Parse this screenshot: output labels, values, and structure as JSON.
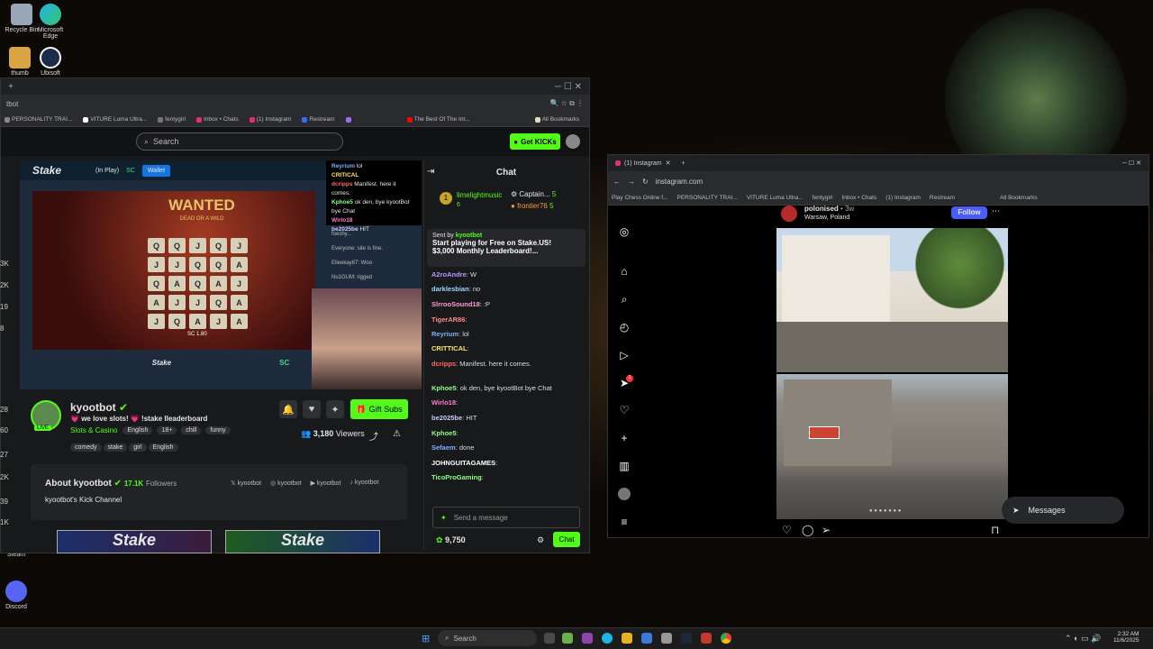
{
  "desktop": {
    "icons": [
      {
        "label": "Recycle Bin"
      },
      {
        "label": "Microsoft Edge"
      },
      {
        "label": "thumb"
      },
      {
        "label": "Ubisoft"
      },
      {
        "label": "Steam"
      },
      {
        "label": "Discord"
      }
    ],
    "edge_numbers": [
      "3K",
      "2K",
      "19",
      "8",
      "28",
      "60",
      "27",
      "2K",
      "39",
      "1K"
    ]
  },
  "kick_window": {
    "tab_title": "tbot",
    "bookmarks": [
      "PERSONALITY TRAI...",
      "VITURE Luma Ultra...",
      "fentygirl",
      "Inbox • Chats",
      "(1) Instagram",
      "Restream",
      "The Best Of The Int...",
      "All Bookmarks"
    ],
    "search_placeholder": "Search",
    "get_kicks_label": "Get KICKs",
    "stream": {
      "site_logo": "Stake",
      "in_play": "(In Play)",
      "currency": "SC",
      "wallet_label": "Wallet",
      "game_title": "WANTED",
      "game_subtitle": "DEAD OR A WILD",
      "balance": "SC 1.80",
      "footer_logo": "Stake",
      "footer_currency": "SC",
      "overlay_chat": [
        {
          "user": "Reyrium",
          "msg": "lol"
        },
        {
          "user": "CRITICAL",
          "msg": ""
        },
        {
          "user": "dcripps",
          "msg": "Manifest. here it comes."
        },
        {
          "user": "Kphoe5",
          "msg": "ok den, bye kyootBot bye Chat"
        },
        {
          "user": "Wirlo18",
          "msg": ""
        },
        {
          "user": "be2025be",
          "msg": "HIT"
        }
      ],
      "overlay_chat2": [
        "foeshy...",
        "Everyone: site is fine.",
        "Elleekay87: Woo",
        "Nu1GUM: rigged"
      ]
    },
    "streamer": {
      "name": "kyootbot",
      "title": "we love slots! 💗 !stake lleaderboard",
      "category": "Slots & Casino",
      "tags": [
        "English",
        "18+",
        "chill",
        "funny"
      ],
      "tags2": [
        "comedy",
        "stake",
        "girl",
        "English"
      ],
      "viewers": "3,180",
      "viewers_label": "Viewers",
      "live_label": "LIVE",
      "gift_subs": "Gift Subs"
    },
    "about": {
      "title": "About kyootbot",
      "followers": "17.1K",
      "followers_label": "Followers",
      "description": "kyootbot's Kick Channel",
      "socials": [
        "kyootbot",
        "kyootbot",
        "kyootbot",
        "kyootbot"
      ]
    },
    "banners": [
      "Stake",
      "Stake"
    ],
    "chat": {
      "header": "Chat",
      "leaders": [
        {
          "rank": "1",
          "name": "limelightmusic",
          "count": "6"
        },
        {
          "name": "Captain...",
          "count": "5"
        },
        {
          "name": "frontier76",
          "count": "5"
        }
      ],
      "pinned": {
        "sent_by": "Sent by",
        "pinner": "kyootbot",
        "line1": "Start playing for Free on Stake.US!",
        "line2": "$3,000 Monthly Leaderboard!..."
      },
      "messages": [
        {
          "user": "A2roAndre",
          "color": "#b59bff",
          "msg": "W"
        },
        {
          "user": "darklesbian",
          "color": "#9fd6ff",
          "msg": "no"
        },
        {
          "user": "SlrrooSound18",
          "color": "#ff9bd4",
          "msg": ":P"
        },
        {
          "user": "TigerAR86",
          "color": "#ff8a8a",
          "msg": ""
        },
        {
          "user": "Reyrium",
          "color": "#7fb0ff",
          "msg": "lol"
        },
        {
          "user": "CRITTICAL",
          "color": "#ffe66b",
          "msg": ""
        },
        {
          "user": "dcripps",
          "color": "#ff6b6b",
          "msg": "Manifest. here it comes."
        },
        {
          "user": "Kphoe5",
          "color": "#8cff8c",
          "msg": "ok den, bye kyootBot bye Chat"
        },
        {
          "user": "Wirlo18",
          "color": "#ff7ad1",
          "msg": ""
        },
        {
          "user": "be2025be",
          "color": "#c8c8ff",
          "msg": "HIT"
        },
        {
          "user": "Kphoe5",
          "color": "#8cff8c",
          "msg": ""
        },
        {
          "user": "Sefaem",
          "color": "#7fb0ff",
          "msg": "done"
        },
        {
          "user": "JOHNGUITAGAMES",
          "color": "#ffffff",
          "msg": ""
        },
        {
          "user": "TicoProGaming",
          "color": "#8cff8c",
          "msg": ""
        }
      ],
      "input_placeholder": "Send a message",
      "points": "9,750",
      "send_label": "Chat"
    }
  },
  "instagram_window": {
    "tab_title": "(1) Instagram",
    "url": "instagram.com",
    "bookmarks": [
      "Play Chess Online f...",
      "PERSONALITY TRAI...",
      "VITURE Luma Ultra...",
      "fentygirl",
      "Inbox • Chats",
      "(1) Instagram",
      "Restream",
      "All Bookmarks"
    ],
    "post": {
      "username": "polonised",
      "age": "3w",
      "location": "Warsaw, Poland",
      "follow_label": "Follow"
    },
    "messages_label": "Messages",
    "notif_count": "1"
  },
  "taskbar": {
    "search_placeholder": "Search",
    "time": "2:32 AM",
    "date": "11/6/2025"
  }
}
